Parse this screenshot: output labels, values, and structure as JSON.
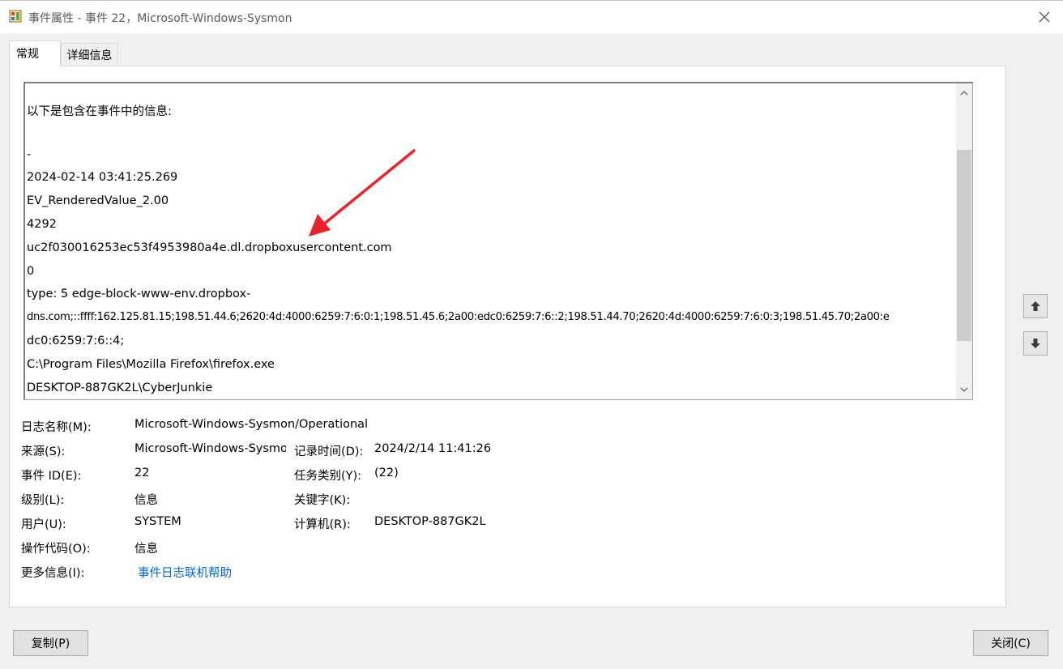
{
  "window": {
    "title": "事件属性 - 事件 22，Microsoft-Windows-Sysmon",
    "app_icon": "event-viewer-icon",
    "close_icon": "close-icon"
  },
  "tabs": [
    {
      "label": "常规",
      "active": true
    },
    {
      "label": "详细信息",
      "active": false
    }
  ],
  "description": {
    "lines": [
      "以下是包含在事件中的信息:",
      "",
      "-",
      "2024-02-14 03:41:25.269",
      "EV_RenderedValue_2.00",
      "4292",
      "uc2f030016253ec53f4953980a4e.dl.dropboxusercontent.com",
      "0",
      "type:  5 edge-block-www-env.dropbox-",
      "dns.com;::ffff:162.125.81.15;198.51.44.6;2620:4d:4000:6259:7:6:0:1;198.51.45.6;2a00:edc0:6259:7:6::2;198.51.44.70;2620:4d:4000:6259:7:6:0:3;198.51.45.70;2a00:e",
      "dc0:6259:7:6::4;",
      "C:\\Program Files\\Mozilla Firefox\\firefox.exe",
      "DESKTOP-887GK2L\\CyberJunkie"
    ]
  },
  "fields": {
    "log_name_label": "日志名称(M):",
    "log_name_value": "Microsoft-Windows-Sysmon/Operational",
    "source_label": "来源(S):",
    "source_value": "Microsoft-Windows-Sysmon",
    "logged_label": "记录时间(D):",
    "logged_value": "2024/2/14 11:41:26",
    "event_id_label": "事件 ID(E):",
    "event_id_value": "22",
    "task_label": "任务类别(Y):",
    "task_value": "(22)",
    "level_label": "级别(L):",
    "level_value": "信息",
    "keywords_label": "关键字(K):",
    "user_label": "用户(U):",
    "user_value": "SYSTEM",
    "computer_label": "计算机(R):",
    "computer_value": "DESKTOP-887GK2L",
    "opcode_label": "操作代码(O):",
    "opcode_value": "信息",
    "more_info_label": "更多信息(I):",
    "more_info_link": "事件日志联机帮助"
  },
  "buttons": {
    "copy": "复制(P)",
    "close": "关闭(C)"
  },
  "colors": {
    "link": "#0066cc",
    "annotation_arrow": "#e8232a"
  }
}
